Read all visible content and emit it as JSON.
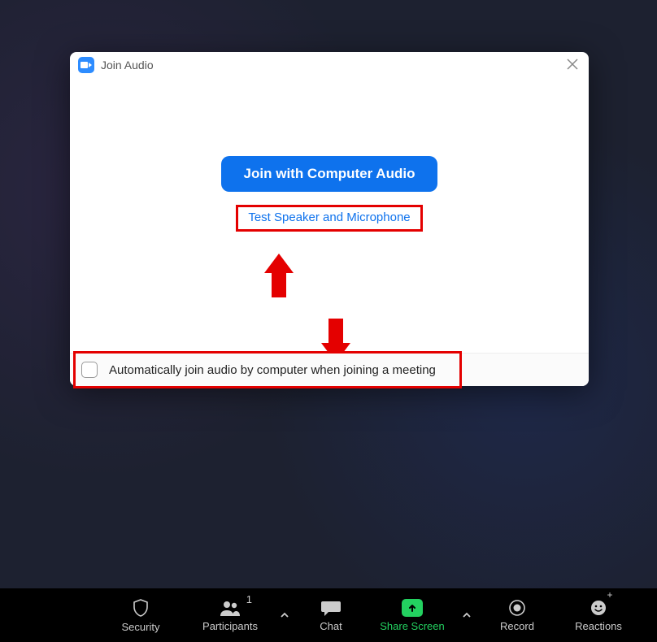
{
  "dialog": {
    "title": "Join Audio",
    "primary_button": "Join with Computer Audio",
    "test_link": "Test Speaker and Microphone",
    "auto_join_label": "Automatically join audio by computer when joining a meeting",
    "auto_join_checked": false
  },
  "toolbar": {
    "security": "Security",
    "participants": "Participants",
    "participants_count": "1",
    "chat": "Chat",
    "share_screen": "Share Screen",
    "record": "Record",
    "reactions": "Reactions"
  },
  "annotations": {
    "highlight_test_link": true,
    "arrow_up": true,
    "arrow_down": true,
    "highlight_footer": true
  }
}
